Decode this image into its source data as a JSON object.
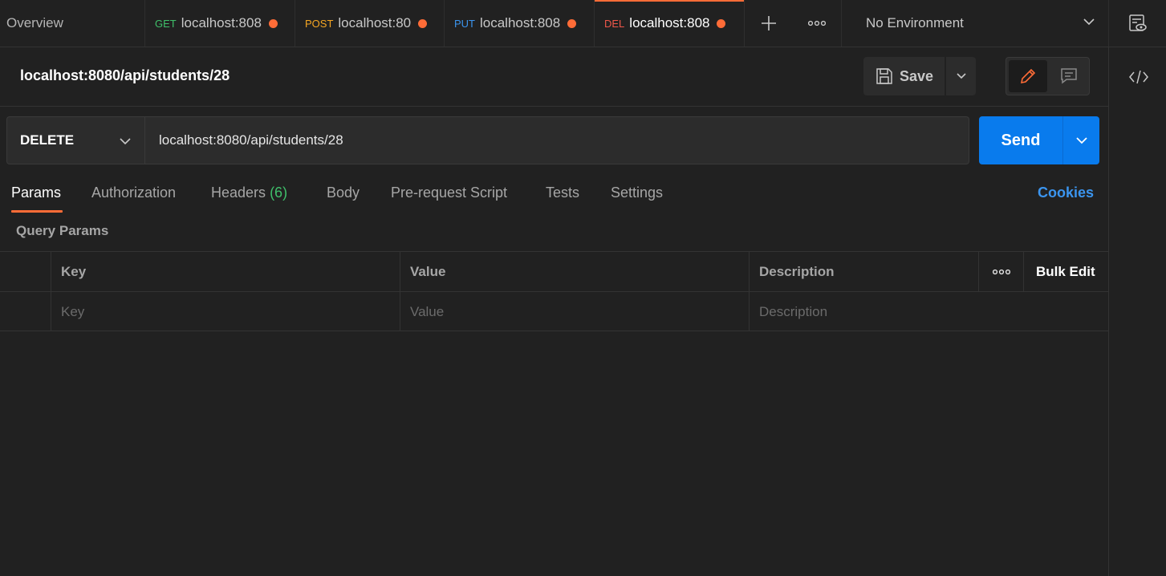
{
  "tabs": {
    "overview": "Overview",
    "requests": [
      {
        "method": "GET",
        "label": "localhost:808",
        "method_color": "#3fbf6a",
        "active": false
      },
      {
        "method": "POST",
        "label": "localhost:80",
        "method_color": "#f5a623",
        "active": false
      },
      {
        "method": "PUT",
        "label": "localhost:808",
        "method_color": "#3b95ef",
        "active": false
      },
      {
        "method": "DEL",
        "label": "localhost:808",
        "method_color": "#f0574a",
        "active": true
      }
    ],
    "add_icon": "plus-icon",
    "more_icon": "more-icon"
  },
  "environment": {
    "selected": "No Environment",
    "eye_icon": "environment-quicklook-icon"
  },
  "request": {
    "title": "localhost:8080/api/students/28",
    "save_label": "Save",
    "method": "DELETE",
    "url": "localhost:8080/api/students/28",
    "send_label": "Send"
  },
  "subtabs": {
    "params": "Params",
    "authorization": "Authorization",
    "headers": "Headers",
    "headers_count": "(6)",
    "body": "Body",
    "prerequest": "Pre-request Script",
    "tests": "Tests",
    "settings": "Settings",
    "cookies": "Cookies"
  },
  "query_params": {
    "label": "Query Params",
    "columns": {
      "key": "Key",
      "value": "Value",
      "description": "Description",
      "bulk_edit": "Bulk Edit"
    },
    "placeholder_row": {
      "key": "Key",
      "value": "Value",
      "description": "Description"
    }
  },
  "colors": {
    "accent": "#ff6c37",
    "send": "#097bed",
    "link": "#3b95ef"
  }
}
